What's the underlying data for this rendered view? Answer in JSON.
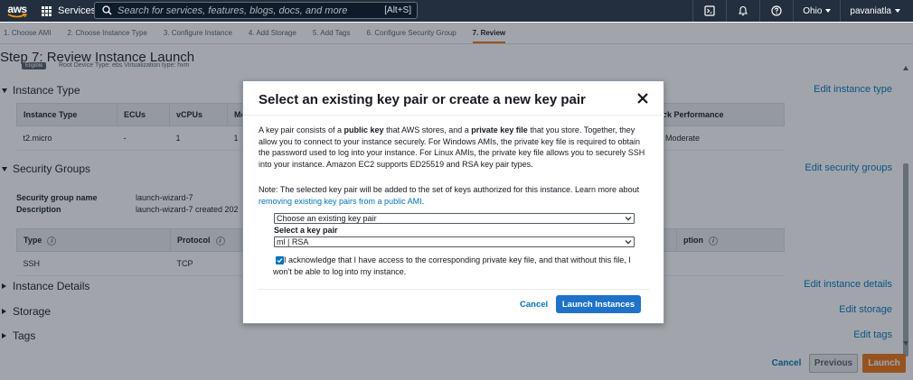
{
  "topnav": {
    "logo": "aws",
    "services_label": "Services",
    "search_placeholder": "Search for services, features, blogs, docs, and more",
    "search_shortcut": "[Alt+S]",
    "region": "Ohio",
    "user": "pavaniatla"
  },
  "steps": [
    {
      "label": "1. Choose AMI"
    },
    {
      "label": "2. Choose Instance Type"
    },
    {
      "label": "3. Configure Instance"
    },
    {
      "label": "4. Add Storage"
    },
    {
      "label": "5. Add Tags"
    },
    {
      "label": "6. Configure Security Group"
    },
    {
      "label": "7. Review",
      "active": true
    }
  ],
  "page": {
    "title": "Step 7: Review Instance Launch",
    "ami_badge": "Eligible",
    "ami_sub": "Root Device Type: ebs    Virtualization type: hvm",
    "instance_type": {
      "heading": "Instance Type",
      "edit": "Edit instance type",
      "headers": [
        "Instance Type",
        "ECUs",
        "vCPUs",
        "Me",
        "ork Performance"
      ],
      "row": [
        "t2.micro",
        "-",
        "1",
        "1",
        "o Moderate"
      ]
    },
    "security_groups": {
      "heading": "Security Groups",
      "edit": "Edit security groups",
      "name_label": "Security group name",
      "name_value": "launch-wizard-7",
      "desc_label": "Description",
      "desc_value": "launch-wizard-7 created 202",
      "headers": [
        "Type",
        "Protocol",
        "ption"
      ],
      "row": [
        "SSH",
        "TCP"
      ]
    },
    "instance_details": {
      "heading": "Instance Details",
      "edit": "Edit instance details"
    },
    "storage": {
      "heading": "Storage",
      "edit": "Edit storage"
    },
    "tags": {
      "heading": "Tags",
      "edit": "Edit tags"
    },
    "footer": {
      "cancel": "Cancel",
      "previous": "Previous",
      "launch": "Launch"
    }
  },
  "modal": {
    "title": "Select an existing key pair or create a new key pair",
    "p1_a": "A key pair consists of a ",
    "p1_b": "public key",
    "p1_c": " that AWS stores, and a ",
    "p1_d": "private key file",
    "p1_e": " that you store. Together, they allow you to connect to your instance securely. For Windows AMIs, the private key file is required to obtain the password used to log into your instance. For Linux AMIs, the private key file allows you to securely SSH into your instance. Amazon EC2 supports ED25519 and RSA key pair types.",
    "p2_a": "Note: The selected key pair will be added to the set of keys authorized for this instance. Learn more about ",
    "p2_link": "removing existing key pairs from a public AMI",
    "p2_b": ".",
    "choice_select": "Choose an existing key pair",
    "keypair_label": "Select a key pair",
    "keypair_select": "ml | RSA",
    "ack": "I acknowledge that I have access to the corresponding private key file, and that without this file, I won't be able to log into my instance.",
    "ack_checked": true,
    "cancel": "Cancel",
    "launch": "Launch Instances"
  },
  "colors": {
    "nav_bg": "#232f3e",
    "link": "#0073bb",
    "primary": "#1e72c9",
    "launch": "#ec7211"
  }
}
